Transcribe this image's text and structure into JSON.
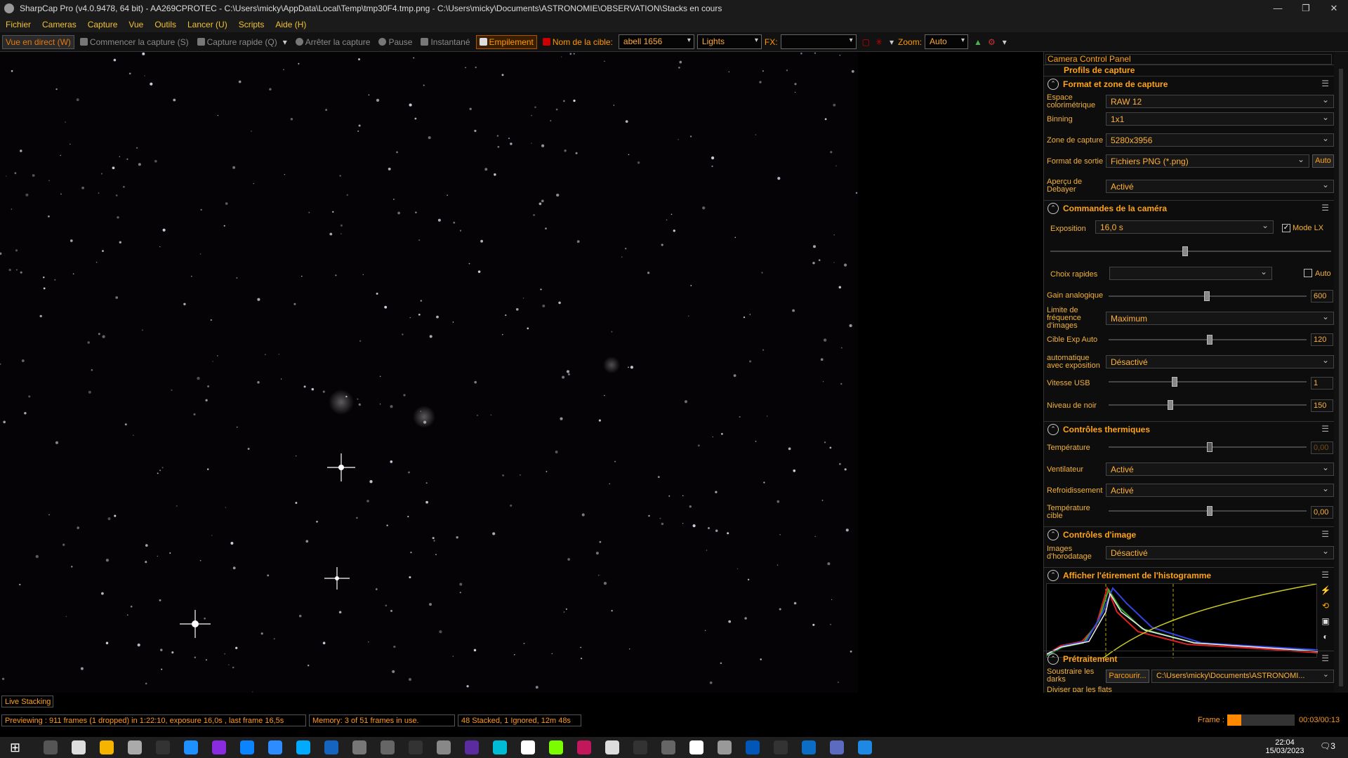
{
  "title": "SharpCap Pro (v4.0.9478, 64 bit) - AA269CPROTEC - C:\\Users\\micky\\AppData\\Local\\Temp\\tmp30F4.tmp.png - C:\\Users\\micky\\Documents\\ASTRONOMIE\\OBSERVATION\\Stacks en cours",
  "menu": [
    "Fichier",
    "Cameras",
    "Capture",
    "Vue",
    "Outils",
    "Lancer (U)",
    "Scripts",
    "Aide (H)"
  ],
  "toolbar": {
    "live": "Vue en direct (W)",
    "start": "Commencer la capture (S)",
    "quick": "Capture rapide (Q)",
    "stop": "Arrêter la capture",
    "pause": "Pause",
    "snap": "Instantané",
    "stack": "Empilement",
    "target_label": "Nom de la cible:",
    "target": "abell 1656",
    "frame_type": "Lights",
    "fx_label": "FX:",
    "fx": "",
    "zoom_label": "Zoom:",
    "zoom": "Auto"
  },
  "panel": {
    "header": "Camera Control Panel",
    "profile": "Profils de capture",
    "format": {
      "title": "Format et zone de capture",
      "color_space_l": "Espace colorimétrique",
      "color_space": "RAW 12",
      "binning_l": "Binning",
      "binning": "1x1",
      "zone_l": "Zone de capture",
      "zone": "5280x3956",
      "output_l": "Format de sortie",
      "output": "Fichiers PNG (*.png)",
      "auto": "Auto",
      "debayer_l": "Aperçu de Debayer",
      "debayer": "Activé"
    },
    "camera": {
      "title": "Commandes de la caméra",
      "exposure_l": "Exposition",
      "exposure": "16,0 s",
      "lx": "Mode LX",
      "quick_l": "Choix rapides",
      "quick_auto": "Auto",
      "gain_l": "Gain analogique",
      "gain": "600",
      "fps_l": "Limite de fréquence d'images",
      "fps": "Maximum",
      "autoexp_l": "Cible Exp Auto",
      "autoexp": "120",
      "autoexp2_l": "automatique avec exposition",
      "autoexp2": "Désactivé",
      "usb_l": "Vitesse USB",
      "usb": "1",
      "black_l": "Niveau de noir",
      "black": "150"
    },
    "thermal": {
      "title": "Contrôles thermiques",
      "temp_l": "Température",
      "temp": "0,00",
      "fan_l": "Ventilateur",
      "fan": "Activé",
      "cool_l": "Refroidissement",
      "cool": "Activé",
      "target_l": "Température cible",
      "target": "0,00"
    },
    "image": {
      "title": "Contrôles d'image",
      "timestamp_l": "Images d'horodatage",
      "timestamp": "Désactivé"
    },
    "histo": {
      "title": "Afficher l'étirement de l'histogramme"
    },
    "pre": {
      "title": "Prétraitement",
      "darks_l": "Soustraire les darks",
      "browse": "Parcourir...",
      "darks_path": "C:\\Users\\micky\\Documents\\ASTRONOMI...",
      "flats_l": "Diviser par les flats"
    }
  },
  "status": {
    "tab": "Live Stacking",
    "preview": "Previewing : 911 frames (1 dropped) in 1:22:10, exposure 16,0s , last frame 16,5s",
    "memory": "Memory: 3 of 51 frames in use.",
    "stacked": "48 Stacked, 1 Ignored, 12m 48s",
    "frame_l": "Frame :",
    "frame": "00:03/00:13"
  },
  "clock": {
    "time": "22:04",
    "date": "15/03/2023",
    "notif": "3"
  },
  "colors": {
    "accent": "#ffa317",
    "text": "#ff9a1f"
  }
}
